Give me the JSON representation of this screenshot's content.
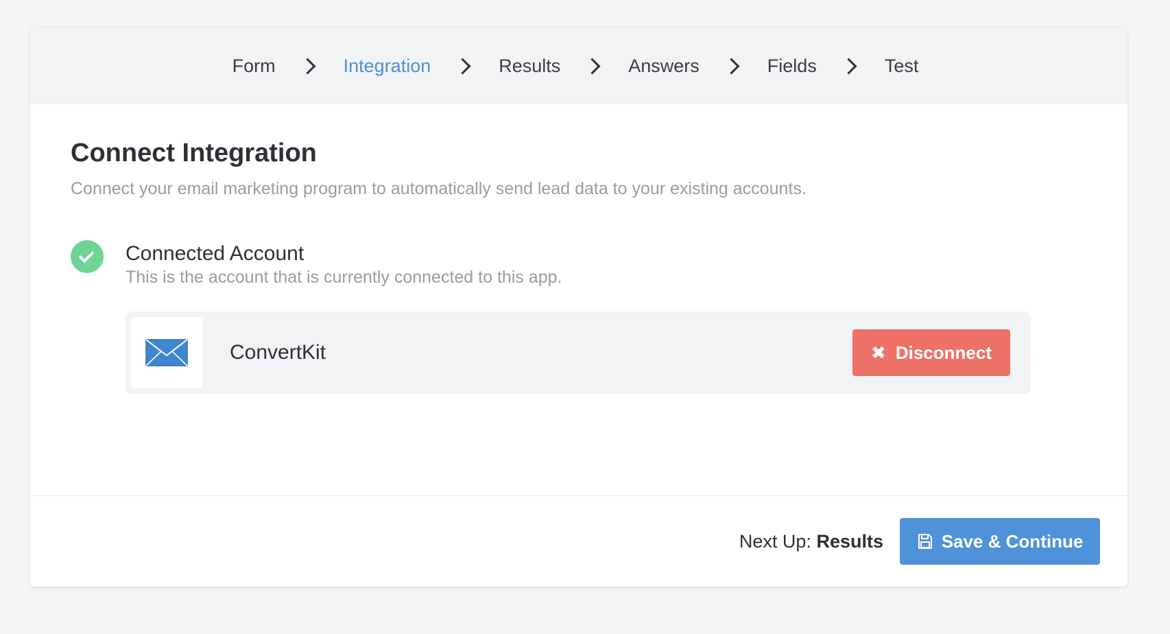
{
  "stepper": {
    "steps": [
      {
        "label": "Form",
        "active": false
      },
      {
        "label": "Integration",
        "active": true
      },
      {
        "label": "Results",
        "active": false
      },
      {
        "label": "Answers",
        "active": false
      },
      {
        "label": "Fields",
        "active": false
      },
      {
        "label": "Test",
        "active": false
      }
    ],
    "active_color": "#4a90d9"
  },
  "main": {
    "title": "Connect Integration",
    "subtitle": "Connect your email marketing program to automatically send lead data to your existing accounts.",
    "connected_section": {
      "icon": "check-circle-icon",
      "title": "Connected Account",
      "subtitle": "This is the account that is currently connected to this app.",
      "account": {
        "logo_icon": "envelope-icon",
        "name": "ConvertKit",
        "disconnect_icon": "x-icon",
        "disconnect_label": "Disconnect"
      }
    }
  },
  "footer": {
    "next_up_label": "Next Up:",
    "next_up_value": "Results",
    "save_icon": "floppy-disk-icon",
    "save_label": "Save & Continue"
  },
  "colors": {
    "success": "#6fd394",
    "danger": "#ee7267",
    "primary": "#4f92da"
  }
}
